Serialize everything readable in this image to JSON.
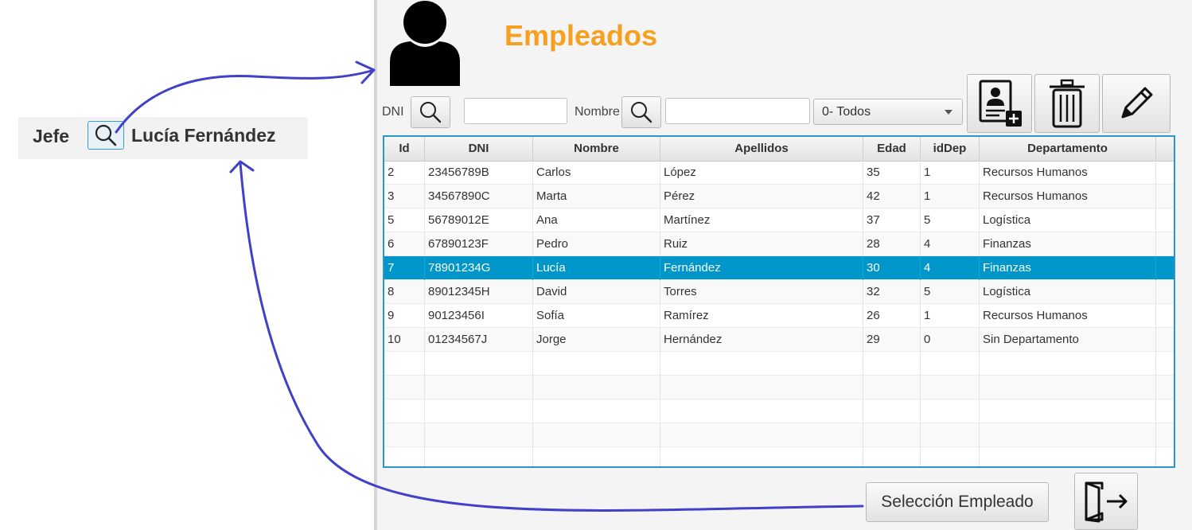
{
  "fragment": {
    "label": "Jefe",
    "value": "Lucía Fernández"
  },
  "window": {
    "title": "Empleados",
    "filters": {
      "dni_label": "DNI",
      "dni_value": "",
      "nombre_label": "Nombre",
      "nombre_value": "",
      "departamento_selected": "0- Todos"
    },
    "toolbar": [
      "add-employee-icon",
      "trash-icon",
      "pencil-icon"
    ],
    "table": {
      "columns": [
        "Id",
        "DNI",
        "Nombre",
        "Apellidos",
        "Edad",
        "idDep",
        "Departamento"
      ],
      "rows": [
        [
          "2",
          "23456789B",
          "Carlos",
          "López",
          "35",
          "1",
          "Recursos Humanos"
        ],
        [
          "3",
          "34567890C",
          "Marta",
          "Pérez",
          "42",
          "1",
          "Recursos Humanos"
        ],
        [
          "5",
          "56789012E",
          "Ana",
          "Martínez",
          "37",
          "5",
          "Logística"
        ],
        [
          "6",
          "67890123F",
          "Pedro",
          "Ruiz",
          "28",
          "4",
          "Finanzas"
        ],
        [
          "7",
          "78901234G",
          "Lucía",
          "Fernández",
          "30",
          "4",
          "Finanzas"
        ],
        [
          "8",
          "89012345H",
          "David",
          "Torres",
          "32",
          "5",
          "Logística"
        ],
        [
          "9",
          "90123456I",
          "Sofía",
          "Ramírez",
          "26",
          "1",
          "Recursos Humanos"
        ],
        [
          "10",
          "01234567J",
          "Jorge",
          "Hernández",
          "29",
          "0",
          "Sin Departamento"
        ]
      ],
      "selected_row_index": 4,
      "empty_rows": 5
    },
    "select_button_label": "Selección Empleado",
    "exit_icon": "exit-door-icon"
  },
  "colors": {
    "title": "#f5a020",
    "selection": "#0096c9",
    "table_border": "#2a95d1",
    "arrows": "#4040c8"
  }
}
